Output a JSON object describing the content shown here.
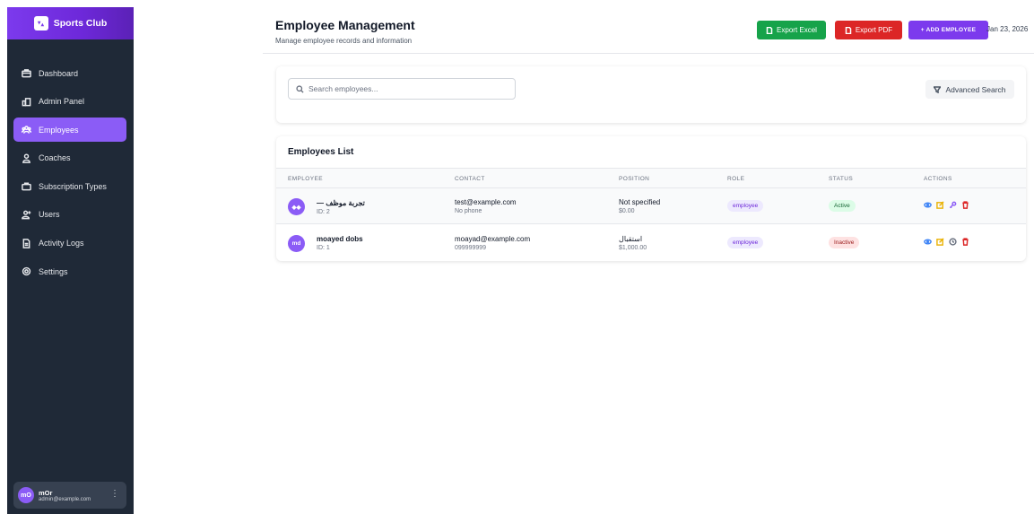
{
  "app": {
    "brand_name": "Sports Club"
  },
  "sidebar": {
    "items": [
      {
        "label": "Dashboard",
        "icon": "briefcase-icon"
      },
      {
        "label": "Admin Panel",
        "icon": "admin-icon"
      },
      {
        "label": "Employees",
        "icon": "users-group-icon",
        "active": true
      },
      {
        "label": "Coaches",
        "icon": "user-icon"
      },
      {
        "label": "Subscription Types",
        "icon": "bag-icon"
      },
      {
        "label": "Users",
        "icon": "user-add-icon"
      },
      {
        "label": "Activity Logs",
        "icon": "document-icon"
      },
      {
        "label": "Settings",
        "icon": "gear-icon"
      }
    ],
    "user": {
      "initials": "mO",
      "name": "mOr",
      "email": "admin@example.com"
    }
  },
  "header": {
    "title": "Employee Management",
    "subtitle": "Manage employee records and information",
    "export_excel_label": "Export Excel",
    "export_pdf_label": "Export PDF",
    "add_employee_label": "+ ADD EMPLOYEE",
    "date": "Jan 23, 2026"
  },
  "search": {
    "placeholder": "Search employees...",
    "value": "",
    "advanced_label": "Advanced Search"
  },
  "table": {
    "title": "Employees List",
    "columns": [
      "EMPLOYEE",
      "CONTACT",
      "POSITION",
      "ROLE",
      "STATUS",
      "ACTIONS"
    ],
    "rows": [
      {
        "initials": "◆◆",
        "name": "— تجربة موظف",
        "id": "ID: 2",
        "email": "test@example.com",
        "phone": "No phone",
        "position": "Not specified",
        "salary": "$0.00",
        "role": "employee",
        "status": "Active"
      },
      {
        "initials": "md",
        "name": "moayed dobs",
        "id": "ID: 1",
        "email": "moayad@example.com",
        "phone": "099999999",
        "position": "استقبال",
        "salary": "$1,000.00",
        "role": "employee",
        "status": "Inactive"
      }
    ]
  },
  "colors": {
    "brand": "#7c3aed",
    "sidebar_bg": "#1f2937",
    "active_nav": "#8b5cf6",
    "excel_green": "#16a34a",
    "pdf_red": "#dc2626",
    "active_badge": "#dcfce7",
    "inactive_badge": "#fee2e2"
  }
}
